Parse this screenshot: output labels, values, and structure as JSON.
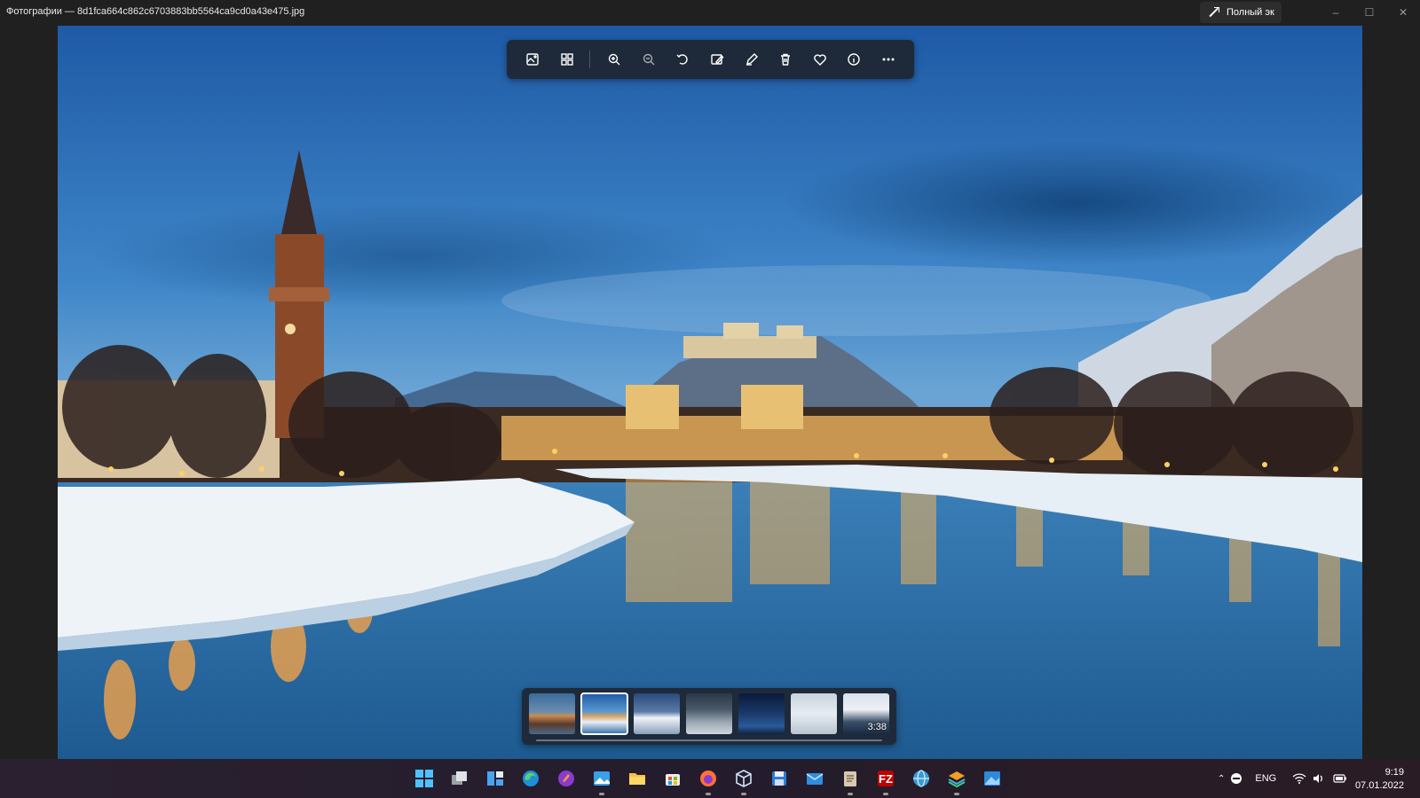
{
  "window": {
    "title": "Фотографии — 8d1fca664c862c6703883bb5564ca9cd0a43e475.jpg",
    "fullscreen_label": "Полный эк",
    "minimize": "–",
    "maximize": "☐",
    "close": "✕"
  },
  "toolbar": {
    "buttons": [
      {
        "name": "view-image-icon"
      },
      {
        "name": "view-all-icon"
      },
      {
        "name": "zoom-in-icon"
      },
      {
        "name": "zoom-out-icon"
      },
      {
        "name": "rotate-icon"
      },
      {
        "name": "edit-image-icon"
      },
      {
        "name": "draw-icon"
      },
      {
        "name": "delete-icon"
      },
      {
        "name": "favorite-icon"
      },
      {
        "name": "info-icon"
      },
      {
        "name": "more-icon"
      }
    ]
  },
  "filmstrip": {
    "selected_index": 1,
    "video_duration": "3:38"
  },
  "taskbar": {
    "apps": [
      "start",
      "task-view",
      "widgets",
      "edge",
      "app-purple",
      "photos",
      "file-explorer",
      "store",
      "firefox",
      "3d-viewer",
      "save-app",
      "mail",
      "notepad",
      "filezilla",
      "globe-app",
      "layers-app",
      "image-app"
    ]
  },
  "tray": {
    "language": "ENG",
    "time": "9:19",
    "date": "07.01.2022"
  },
  "colors": {
    "background": "#202020",
    "toolbar": "#1e2a3a",
    "sky_top": "#1f5fa8",
    "water": "#2b6fa8"
  }
}
